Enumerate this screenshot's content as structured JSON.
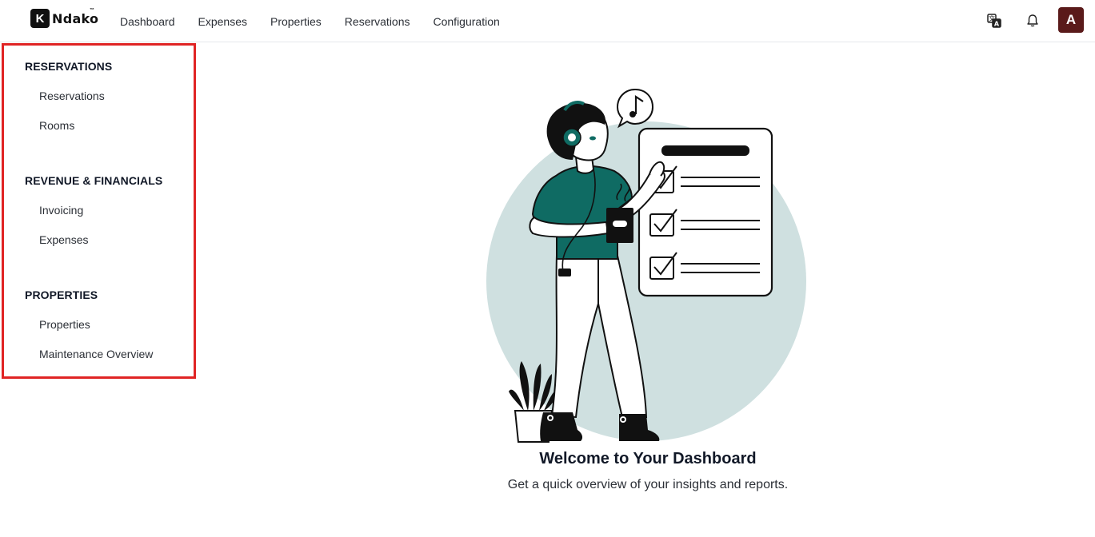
{
  "brand": {
    "mark": "K",
    "name": "Ndako",
    "tm": "™"
  },
  "nav": {
    "items": [
      {
        "label": "Dashboard"
      },
      {
        "label": "Expenses"
      },
      {
        "label": "Properties"
      },
      {
        "label": "Reservations"
      },
      {
        "label": "Configuration"
      }
    ]
  },
  "top_icons": {
    "translate": "translate-icon",
    "notifications": "bell-icon"
  },
  "user": {
    "avatar_initial": "A",
    "avatar_color": "#5a1a1a"
  },
  "sidebar": {
    "highlight_color": "#e02424",
    "sections": [
      {
        "title": "RESERVATIONS",
        "items": [
          {
            "label": "Reservations"
          },
          {
            "label": "Rooms"
          }
        ]
      },
      {
        "title": "REVENUE & FINANCIALS",
        "items": [
          {
            "label": "Invoicing"
          },
          {
            "label": "Expenses"
          }
        ]
      },
      {
        "title": "PROPERTIES",
        "items": [
          {
            "label": "Properties"
          },
          {
            "label": "Maintenance Overview"
          }
        ]
      }
    ]
  },
  "main": {
    "title": "Welcome to Your Dashboard",
    "subtitle": "Get a quick overview of your insights and reports.",
    "accent_color": "#0f6b63",
    "circle_color": "#cfe0e0"
  }
}
